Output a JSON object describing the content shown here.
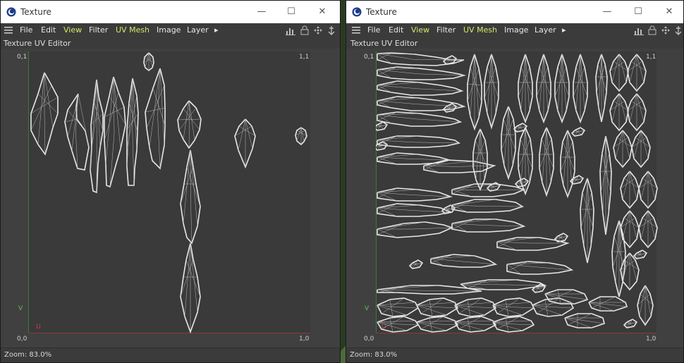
{
  "title": "Texture",
  "window_controls": {
    "minimize": "—",
    "maximize": "☐",
    "close": "✕"
  },
  "menu": {
    "items": [
      {
        "label": "File",
        "accent": false
      },
      {
        "label": "Edit",
        "accent": false
      },
      {
        "label": "View",
        "accent": true
      },
      {
        "label": "Filter",
        "accent": false
      },
      {
        "label": "UV Mesh",
        "accent": true
      },
      {
        "label": "Image",
        "accent": false
      },
      {
        "label": "Layer",
        "accent": false
      }
    ],
    "more": "▸"
  },
  "subtitle": "Texture UV Editor",
  "corner_labels": {
    "top_left": "0,1",
    "top_right": "1,1",
    "bottom_left": "0,0",
    "bottom_right": "1,0"
  },
  "axes": {
    "v": "V",
    "u": "U"
  },
  "status": {
    "zoom": "Zoom: 83.0%"
  },
  "colors": {
    "accent": "#d6e86a",
    "mesh": "#e8e8e8",
    "v_axis": "#3d7a3d",
    "u_axis": "#8a3a3a",
    "panel": "#3b3b3b",
    "viewport": "#3a3a3a"
  },
  "icons": [
    "hamburger-menu-icon",
    "histogram-icon",
    "lock-icon",
    "move-icon",
    "anchor-icon",
    "cinema4d-app-icon"
  ]
}
